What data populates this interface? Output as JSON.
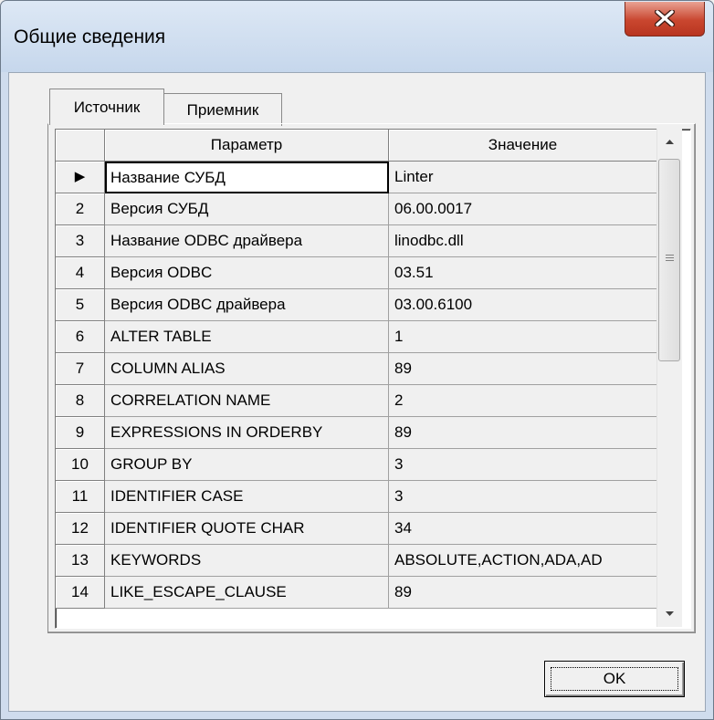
{
  "window": {
    "title": "Общие сведения",
    "close_glyph": "X"
  },
  "tabs": [
    {
      "label": "Источник",
      "active": true
    },
    {
      "label": "Приемник",
      "active": false
    }
  ],
  "grid": {
    "columns": [
      "Параметр",
      "Значение"
    ],
    "current_row_marker": "▶",
    "rows": [
      {
        "num": "",
        "param": "Название СУБД",
        "value": "Linter"
      },
      {
        "num": "2",
        "param": "Версия СУБД",
        "value": "06.00.0017"
      },
      {
        "num": "3",
        "param": "Название ODBC драйвера",
        "value": "linodbc.dll"
      },
      {
        "num": "4",
        "param": "Версия ODBC",
        "value": "03.51"
      },
      {
        "num": "5",
        "param": "Версия ODBC драйвера",
        "value": "03.00.6100"
      },
      {
        "num": "6",
        "param": "ALTER TABLE",
        "value": "1"
      },
      {
        "num": "7",
        "param": "COLUMN ALIAS",
        "value": "89"
      },
      {
        "num": "8",
        "param": "CORRELATION NAME",
        "value": "2"
      },
      {
        "num": "9",
        "param": "EXPRESSIONS IN ORDERBY",
        "value": "89"
      },
      {
        "num": "10",
        "param": "GROUP BY",
        "value": "3"
      },
      {
        "num": "11",
        "param": "IDENTIFIER CASE",
        "value": "3"
      },
      {
        "num": "12",
        "param": "IDENTIFIER QUOTE CHAR",
        "value": "34"
      },
      {
        "num": "13",
        "param": "KEYWORDS",
        "value": "ABSOLUTE,ACTION,ADA,AD"
      },
      {
        "num": "14",
        "param": "LIKE_ESCAPE_CLAUSE",
        "value": "89"
      }
    ]
  },
  "buttons": {
    "ok_label": "OK"
  },
  "icons": {
    "scroll_up": "scroll-up-arrow-icon",
    "scroll_down": "scroll-down-arrow-icon",
    "row_indicator": "current-row-arrow-icon",
    "close": "close-icon"
  }
}
